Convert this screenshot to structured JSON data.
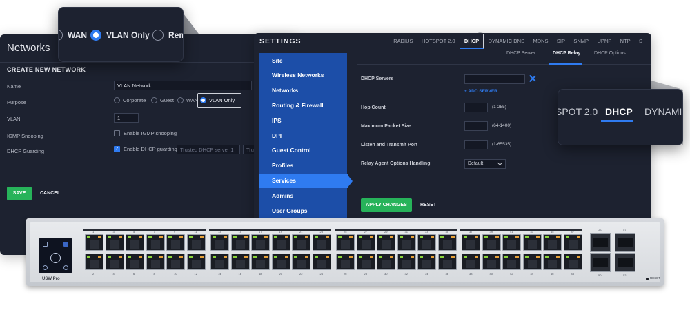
{
  "networks": {
    "title": "Networks",
    "section": "CREATE NEW NETWORK",
    "labels": {
      "name": "Name",
      "purpose": "Purpose",
      "vlan": "VLAN",
      "igmp": "IGMP Snooping",
      "dhcp_guarding": "DHCP Guarding"
    },
    "name_value": "VLAN Network",
    "purpose_options": [
      "Corporate",
      "Guest",
      "WAN",
      "VLAN Only"
    ],
    "purpose_selected": "VLAN Only",
    "vlan_value": "1",
    "igmp_label": "Enable IGMP snooping",
    "dhcp_guarding_label": "Enable DHCP guarding",
    "dhcp_server1_placeholder": "Trusted DHCP server 1",
    "dhcp_server2_placeholder": "Trus",
    "save": "SAVE",
    "cancel": "CANCEL"
  },
  "callout_left": {
    "options": [
      "WAN",
      "VLAN Only",
      "Remo"
    ],
    "selected": "VLAN Only"
  },
  "settings": {
    "title": "SETTINGS",
    "tabs": [
      "RADIUS",
      "HOTSPOT 2.0",
      "DHCP",
      "DYNAMIC DNS",
      "MDNS",
      "SIP",
      "SNMP",
      "UPNP",
      "NTP",
      "S"
    ],
    "active_tab": "DHCP",
    "subtabs": [
      "DHCP Server",
      "DHCP Relay",
      "DHCP Options"
    ],
    "active_subtab": "DHCP Relay",
    "sidebar": [
      "Site",
      "Wireless Networks",
      "Networks",
      "Routing & Firewall",
      "IPS",
      "DPI",
      "Guest Control",
      "Profiles",
      "Services",
      "Admins",
      "User Groups"
    ],
    "sidebar_active": "Services",
    "fields": {
      "dhcp_servers": "DHCP Servers",
      "add_server": "ADD SERVER",
      "hop_count": "Hop Count",
      "hop_count_hint": "(1-255)",
      "max_packet": "Maximum Packet Size",
      "max_packet_hint": "(64-1400)",
      "listen_port": "Listen and Transmit Port",
      "listen_port_hint": "(1-65535)",
      "relay_options": "Relay Agent Options Handling",
      "relay_options_value": "Default"
    },
    "apply": "APPLY CHANGES",
    "reset": "RESET"
  },
  "callout_right": {
    "tabs": [
      "SPOT 2.0",
      "DHCP",
      "DYNAMIC"
    ],
    "active": "DHCP"
  },
  "switch": {
    "model": "USW Pro",
    "top_labels": [
      "1",
      "3",
      "5",
      "7",
      "9",
      "11",
      "13",
      "15",
      "17",
      "19",
      "21",
      "23",
      "25",
      "27",
      "29",
      "31",
      "33",
      "35",
      "37",
      "39",
      "41",
      "43",
      "45",
      "47"
    ],
    "bottom_labels": [
      "2",
      "4",
      "6",
      "8",
      "10",
      "12",
      "14",
      "16",
      "18",
      "20",
      "22",
      "24",
      "26",
      "28",
      "30",
      "32",
      "34",
      "36",
      "38",
      "40",
      "42",
      "44",
      "46",
      "48"
    ],
    "sfp_top": [
      "49",
      "51"
    ],
    "sfp_bottom": [
      "50",
      "52"
    ],
    "reset_label": "RESET",
    "colors": {
      "link_led": "#8bd43c",
      "activity_led": "#e6a23a"
    }
  },
  "colors": {
    "accent": "#2f7bf0",
    "sidebar": "#1c4ea8",
    "panel": "#1d2230",
    "button_green": "#27b35a"
  }
}
